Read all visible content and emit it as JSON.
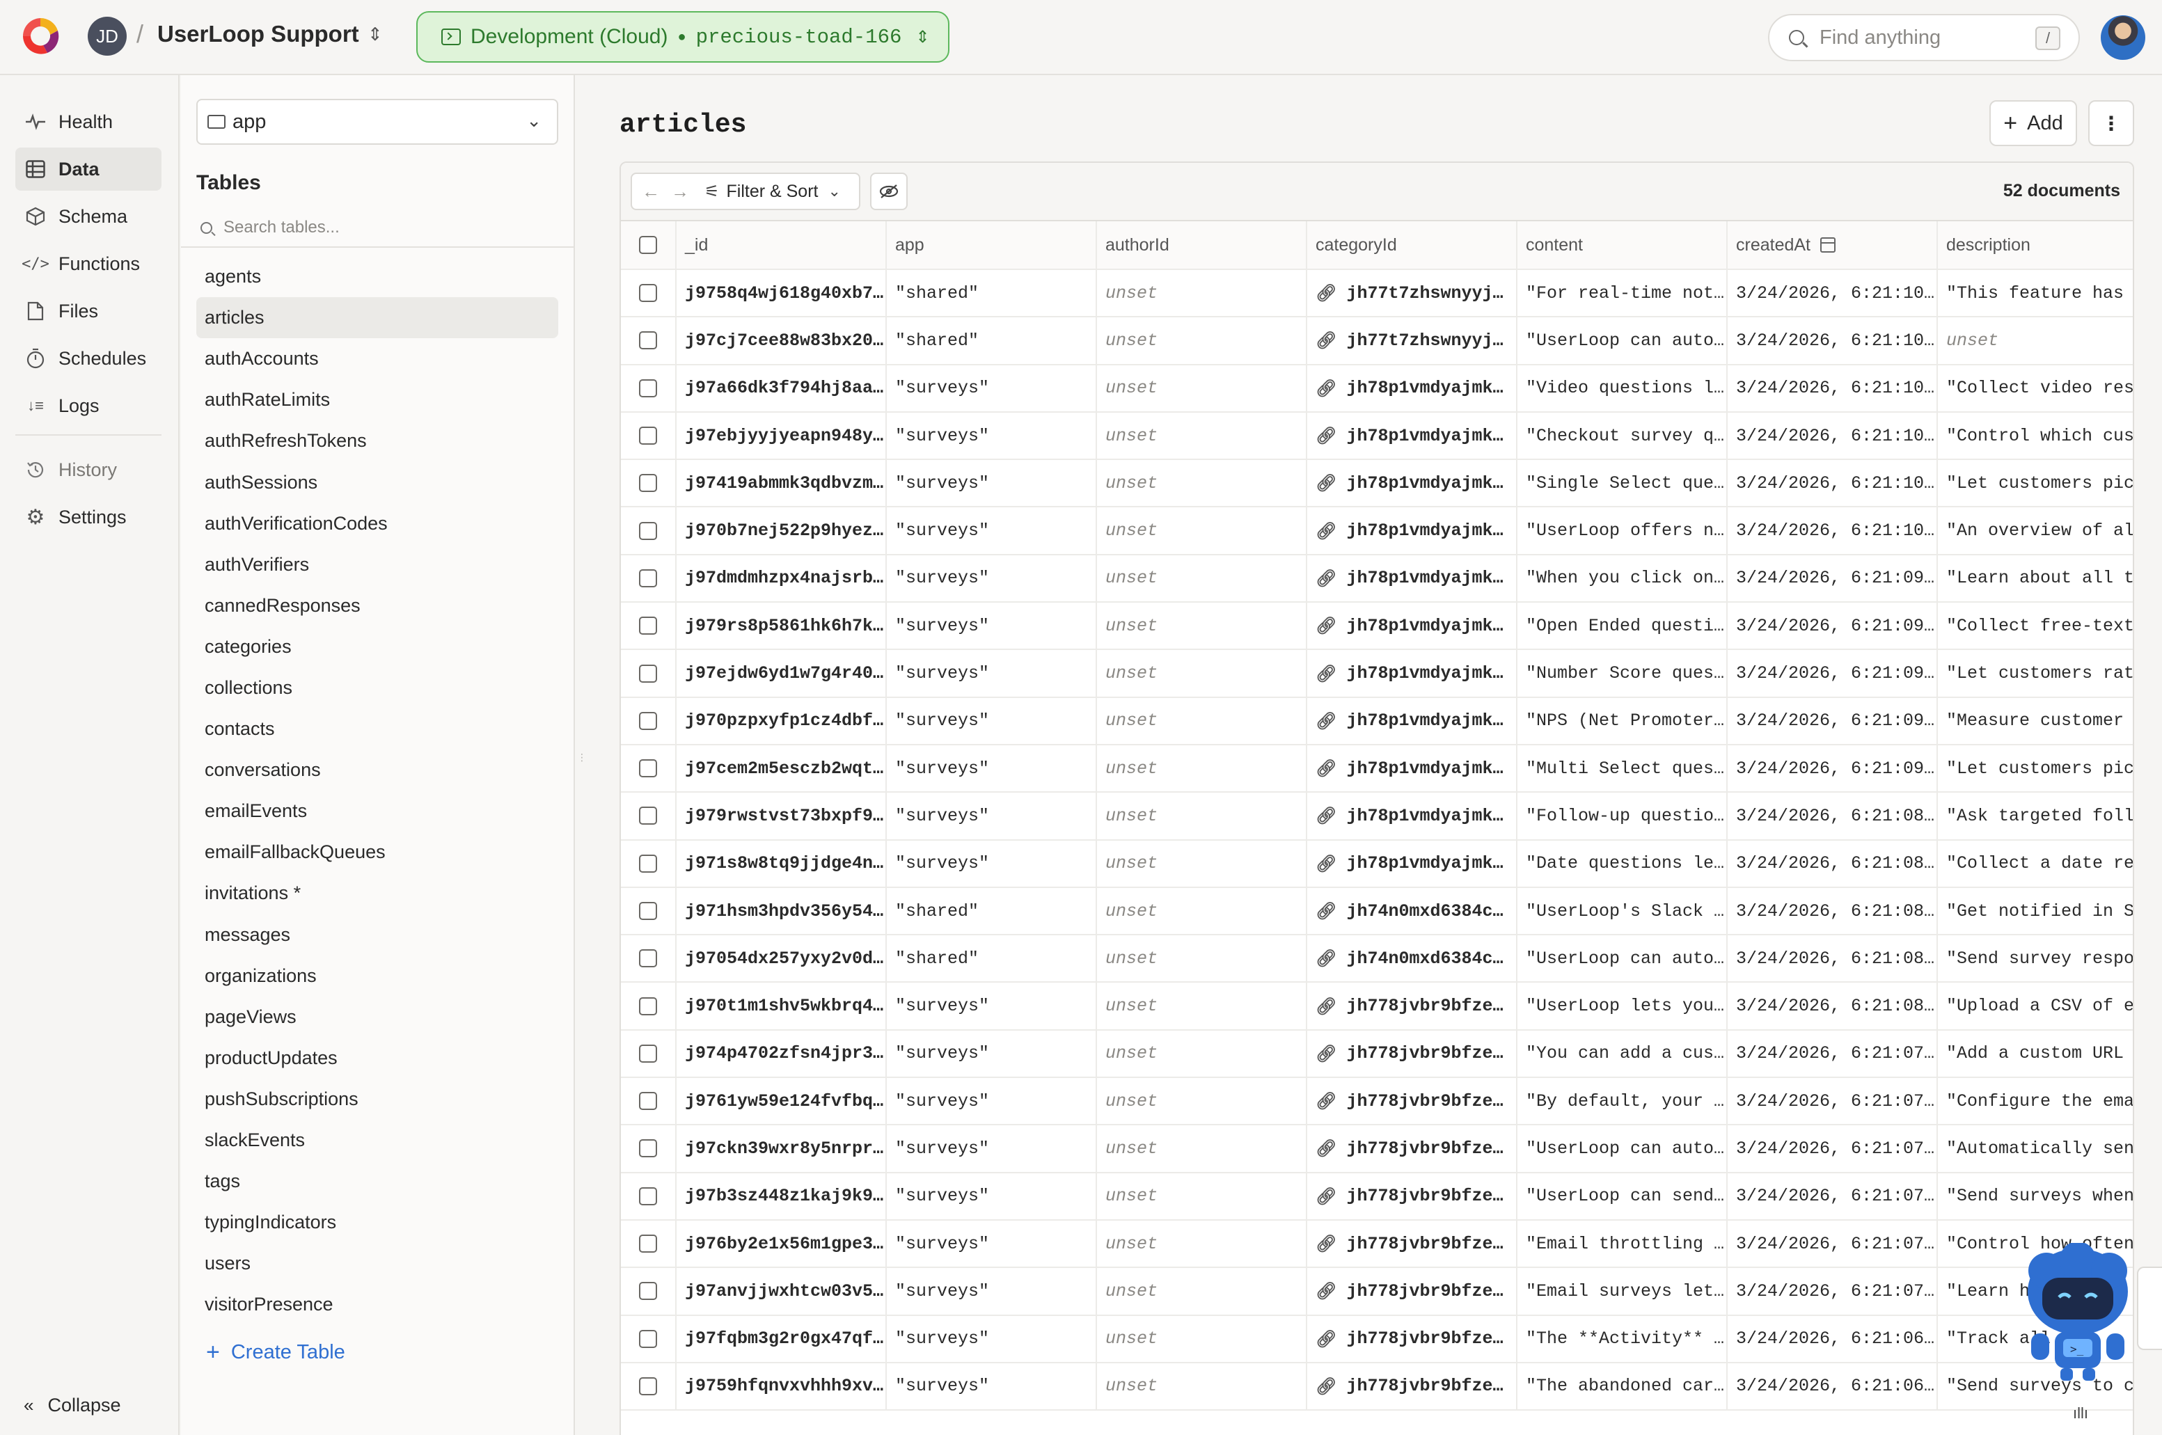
{
  "topbar": {
    "workspace_initials": "JD",
    "separator": "/",
    "project_name": "UserLoop Support",
    "deployment_env": "Development (Cloud)",
    "deployment_name": "precious-toad-166",
    "search_placeholder": "Find anything",
    "search_shortcut": "/"
  },
  "nav": {
    "items": [
      {
        "label": "Health",
        "icon": "pulse-icon"
      },
      {
        "label": "Data",
        "icon": "table-icon"
      },
      {
        "label": "Schema",
        "icon": "cube-icon"
      },
      {
        "label": "Functions",
        "icon": "code-icon"
      },
      {
        "label": "Files",
        "icon": "file-icon"
      },
      {
        "label": "Schedules",
        "icon": "stopwatch-icon"
      },
      {
        "label": "Logs",
        "icon": "logs-icon"
      },
      {
        "label": "History",
        "icon": "history-icon"
      },
      {
        "label": "Settings",
        "icon": "gear-icon"
      }
    ],
    "active": "Data",
    "collapse_label": "Collapse"
  },
  "tables_panel": {
    "component": "app",
    "title": "Tables",
    "search_placeholder": "Search tables...",
    "active_table": "articles",
    "tables": [
      "agents",
      "articles",
      "authAccounts",
      "authRateLimits",
      "authRefreshTokens",
      "authSessions",
      "authVerificationCodes",
      "authVerifiers",
      "cannedResponses",
      "categories",
      "collections",
      "contacts",
      "conversations",
      "emailEvents",
      "emailFallbackQueues",
      "invitations *",
      "messages",
      "organizations",
      "pageViews",
      "productUpdates",
      "pushSubscriptions",
      "slackEvents",
      "tags",
      "typingIndicators",
      "users",
      "visitorPresence"
    ],
    "create_label": "Create Table"
  },
  "main": {
    "title": "articles",
    "add_label": "Add",
    "filter_label": "Filter & Sort",
    "doc_count": "52 documents",
    "columns": [
      "_id",
      "app",
      "authorId",
      "categoryId",
      "content",
      "createdAt",
      "description"
    ],
    "rows": [
      [
        "j9758q4wj618g40xb7…",
        "\"shared\"",
        "unset",
        "jh77t7zhswnyyj…",
        "\"For real-time not…",
        "3/24/2026, 6:21:10…",
        "\"This feature has"
      ],
      [
        "j97cj7cee88w83bx20…",
        "\"shared\"",
        "unset",
        "jh77t7zhswnyyj…",
        "\"UserLoop can auto…",
        "3/24/2026, 6:21:10…",
        "unset"
      ],
      [
        "j97a66dk3f794hj8aa…",
        "\"surveys\"",
        "unset",
        "jh78p1vmdyajmk…",
        "\"Video questions l…",
        "3/24/2026, 6:21:10…",
        "\"Collect video res"
      ],
      [
        "j97ebjyyjyeapn948y…",
        "\"surveys\"",
        "unset",
        "jh78p1vmdyajmk…",
        "\"Checkout survey q…",
        "3/24/2026, 6:21:10…",
        "\"Control which cus"
      ],
      [
        "j97419abmmk3qdbvzm…",
        "\"surveys\"",
        "unset",
        "jh78p1vmdyajmk…",
        "\"Single Select que…",
        "3/24/2026, 6:21:10…",
        "\"Let customers pic"
      ],
      [
        "j970b7nej522p9hyez…",
        "\"surveys\"",
        "unset",
        "jh78p1vmdyajmk…",
        "\"UserLoop offers n…",
        "3/24/2026, 6:21:10…",
        "\"An overview of al"
      ],
      [
        "j97dmdmhzpx4najsrb…",
        "\"surveys\"",
        "unset",
        "jh78p1vmdyajmk…",
        "\"When you click on…",
        "3/24/2026, 6:21:09…",
        "\"Learn about all t"
      ],
      [
        "j979rs8p5861hk6h7k…",
        "\"surveys\"",
        "unset",
        "jh78p1vmdyajmk…",
        "\"Open Ended questi…",
        "3/24/2026, 6:21:09…",
        "\"Collect free-text"
      ],
      [
        "j97ejdw6yd1w7g4r40…",
        "\"surveys\"",
        "unset",
        "jh78p1vmdyajmk…",
        "\"Number Score ques…",
        "3/24/2026, 6:21:09…",
        "\"Let customers rat"
      ],
      [
        "j970pzpxyfp1cz4dbf…",
        "\"surveys\"",
        "unset",
        "jh78p1vmdyajmk…",
        "\"NPS (Net Promoter…",
        "3/24/2026, 6:21:09…",
        "\"Measure customer"
      ],
      [
        "j97cem2m5esczb2wqt…",
        "\"surveys\"",
        "unset",
        "jh78p1vmdyajmk…",
        "\"Multi Select ques…",
        "3/24/2026, 6:21:09…",
        "\"Let customers pic"
      ],
      [
        "j979rwstvst73bxpf9…",
        "\"surveys\"",
        "unset",
        "jh78p1vmdyajmk…",
        "\"Follow-up questio…",
        "3/24/2026, 6:21:08…",
        "\"Ask targeted foll"
      ],
      [
        "j971s8w8tq9jjdge4n…",
        "\"surveys\"",
        "unset",
        "jh78p1vmdyajmk…",
        "\"Date questions le…",
        "3/24/2026, 6:21:08…",
        "\"Collect a date re"
      ],
      [
        "j971hsm3hpdv356y54…",
        "\"shared\"",
        "unset",
        "jh74n0mxd6384c…",
        "\"UserLoop's Slack …",
        "3/24/2026, 6:21:08…",
        "\"Get notified in S"
      ],
      [
        "j97054dx257yxy2v0d…",
        "\"shared\"",
        "unset",
        "jh74n0mxd6384c…",
        "\"UserLoop can auto…",
        "3/24/2026, 6:21:08…",
        "\"Send survey respo"
      ],
      [
        "j970t1m1shv5wkbrq4…",
        "\"surveys\"",
        "unset",
        "jh778jvbr9bfze…",
        "\"UserLoop lets you…",
        "3/24/2026, 6:21:08…",
        "\"Upload a CSV of e"
      ],
      [
        "j974p4702zfsn4jpr3…",
        "\"surveys\"",
        "unset",
        "jh778jvbr9bfze…",
        "\"You can add a cus…",
        "3/24/2026, 6:21:07…",
        "\"Add a custom URL"
      ],
      [
        "j9761yw59e124fvfbq…",
        "\"surveys\"",
        "unset",
        "jh778jvbr9bfze…",
        "\"By default, your …",
        "3/24/2026, 6:21:07…",
        "\"Configure the ema"
      ],
      [
        "j97ckn39wxr8y5nrpr…",
        "\"surveys\"",
        "unset",
        "jh778jvbr9bfze…",
        "\"UserLoop can auto…",
        "3/24/2026, 6:21:07…",
        "\"Automatically sen"
      ],
      [
        "j97b3sz448z1kaj9k9…",
        "\"surveys\"",
        "unset",
        "jh778jvbr9bfze…",
        "\"UserLoop can send…",
        "3/24/2026, 6:21:07…",
        "\"Send surveys when"
      ],
      [
        "j976by2e1x56m1gpe3…",
        "\"surveys\"",
        "unset",
        "jh778jvbr9bfze…",
        "\"Email throttling …",
        "3/24/2026, 6:21:07…",
        "\"Control how often"
      ],
      [
        "j97anvjjwxhtcw03v5…",
        "\"surveys\"",
        "unset",
        "jh778jvbr9bfze…",
        "\"Email surveys let…",
        "3/24/2026, 6:21:07…",
        "\"Learn h"
      ],
      [
        "j97fqbm3g2r0gx47qf…",
        "\"surveys\"",
        "unset",
        "jh778jvbr9bfze…",
        "\"The **Activity** …",
        "3/24/2026, 6:21:06…",
        "\"Track all"
      ],
      [
        "j9759hfqnvxvhhh9xv…",
        "\"surveys\"",
        "unset",
        "jh778jvbr9bfze…",
        "\"The abandoned car…",
        "3/24/2026, 6:21:06…",
        "\"Send surveys to c"
      ]
    ]
  },
  "colors": {
    "accent_green": "#2d7a2d",
    "pill_bg": "#dff3d9",
    "link_blue": "#2f6fd1",
    "mascot_blue": "#2f6fd1"
  }
}
